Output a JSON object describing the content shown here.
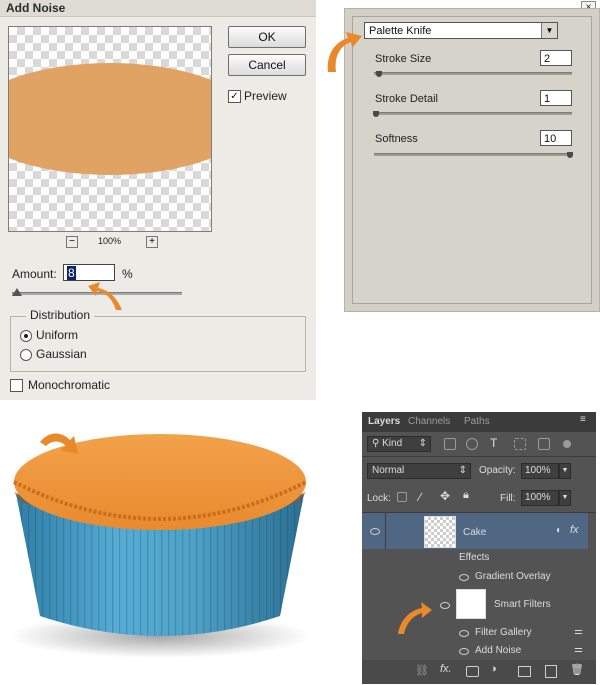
{
  "add_noise": {
    "title": "Add Noise",
    "close_glyph": "×",
    "ok_label": "OK",
    "cancel_label": "Cancel",
    "preview_label": "Preview",
    "preview_checked": true,
    "zoom_out_glyph": "−",
    "zoom_in_glyph": "+",
    "zoom": "100%",
    "amount_label": "Amount:",
    "amount_value": "8",
    "amount_unit": "%",
    "distribution_label": "Distribution",
    "uniform_label": "Uniform",
    "gaussian_label": "Gaussian",
    "selected_distribution": "Uniform",
    "monochromatic_label": "Monochromatic",
    "monochromatic_checked": false
  },
  "palette_knife": {
    "filter": "Palette Knife",
    "params": [
      {
        "label": "Stroke Size",
        "value": "2"
      },
      {
        "label": "Stroke Detail",
        "value": "1"
      },
      {
        "label": "Softness",
        "value": "10"
      }
    ]
  },
  "layers_panel": {
    "tabs": [
      "Layers",
      "Channels",
      "Paths"
    ],
    "kind_label": "Kind",
    "blend_mode": "Normal",
    "opacity_label": "Opacity:",
    "opacity_value": "100%",
    "lock_label": "Lock:",
    "fill_label": "Fill:",
    "fill_value": "100%",
    "layer_name": "Cake",
    "effects_label": "Effects",
    "gradient_overlay_label": "Gradient Overlay",
    "smart_filters_label": "Smart Filters",
    "filter_gallery_label": "Filter Gallery",
    "add_noise_label": "Add Noise",
    "fx_label": "fx"
  },
  "colors": {
    "cake_top": "#e99a45",
    "cup_blue": "#4fa3c8",
    "arrow_orange": "#e8892a"
  }
}
